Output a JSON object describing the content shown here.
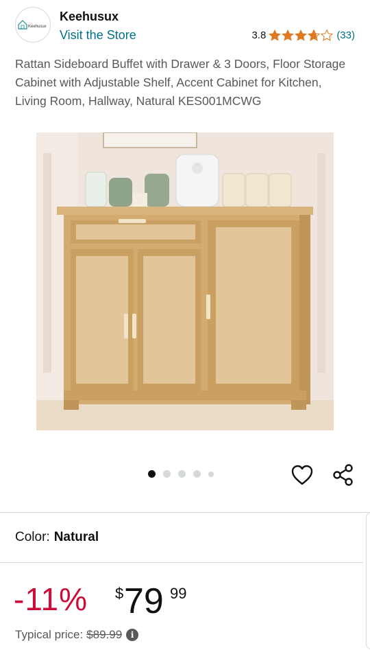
{
  "brand": {
    "name": "Keehusux",
    "logo_text": "Keehusux",
    "store_link": "Visit the Store"
  },
  "rating": {
    "value": "3.8",
    "stars_filled": 3.8,
    "count": "(33)",
    "star_color": "#de7921"
  },
  "product": {
    "title": "Rattan Sideboard Buffet with Drawer & 3 Doors, Floor Storage Cabinet with Adjustable Shelf, Accent Cabinet for Kitchen, Living Room, Hallway, Natural KES001MCWG"
  },
  "carousel": {
    "image_count": 5,
    "active_index": 0
  },
  "color": {
    "label": "Color:",
    "value": "Natural"
  },
  "price": {
    "discount": "-11%",
    "symbol": "$",
    "whole": "79",
    "fraction": "99",
    "typical_label": "Typical price:",
    "typical_value": "$89.99",
    "discount_color": "#cc0c39"
  }
}
